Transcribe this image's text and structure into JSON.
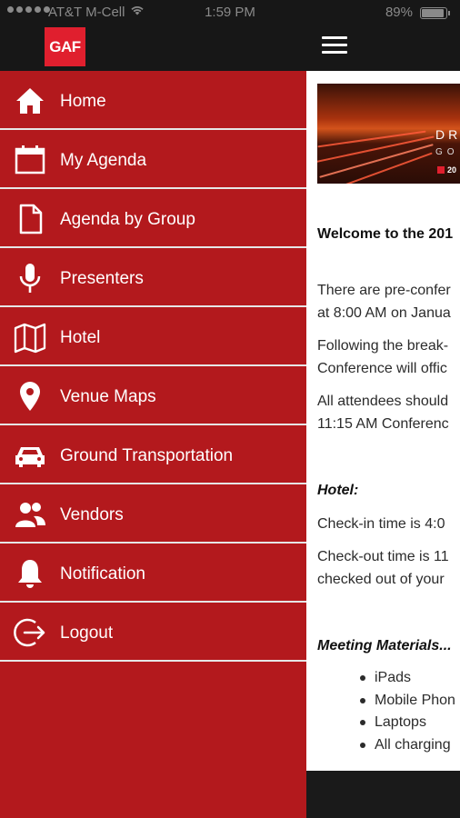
{
  "status_bar": {
    "carrier": "AT&T M-Cell",
    "time": "1:59 PM",
    "battery": "89%"
  },
  "app_bar": {
    "logo_text": "GAF"
  },
  "menu": [
    {
      "label": "Home",
      "icon": "home-icon"
    },
    {
      "label": "My Agenda",
      "icon": "calendar-icon"
    },
    {
      "label": "Agenda by Group",
      "icon": "document-icon"
    },
    {
      "label": "Presenters",
      "icon": "microphone-icon"
    },
    {
      "label": "Hotel",
      "icon": "map-icon"
    },
    {
      "label": "Venue Maps",
      "icon": "location-pin-icon"
    },
    {
      "label": "Ground Transportation",
      "icon": "car-icon"
    },
    {
      "label": "Vendors",
      "icon": "users-icon"
    },
    {
      "label": "Notification",
      "icon": "bell-icon"
    },
    {
      "label": "Logout",
      "icon": "logout-icon"
    }
  ],
  "content": {
    "hero": {
      "line1": "DR",
      "line2": "GO",
      "line3": "20"
    },
    "welcome": "Welcome to the 201",
    "para1_line1": "There are pre-confer",
    "para1_line2": "at 8:00 AM on Janua",
    "para2_line1": "Following the break-",
    "para2_line2": "Conference will offic",
    "para3_line1": "All attendees should",
    "para3_line2": "11:15 AM Conferenc",
    "hotel_heading": "Hotel:",
    "checkin": "Check-in time is 4:0",
    "checkout_line1": "Check-out time is 11",
    "checkout_line2": "checked out of your",
    "materials_heading": "Meeting Materials...",
    "materials": [
      "iPads",
      "Mobile Phon",
      "Laptops",
      "All charging"
    ]
  },
  "colors": {
    "drawer": "#b3191d",
    "logo": "#e01f2e",
    "bar": "#171717"
  }
}
